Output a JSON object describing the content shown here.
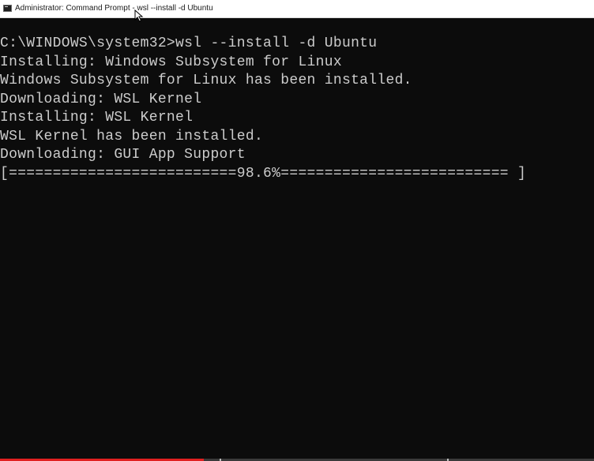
{
  "window": {
    "title": "Administrator: Command Prompt - wsl --install -d Ubuntu",
    "icon": "cmd-icon"
  },
  "console": {
    "lines": [
      "C:\\WINDOWS\\system32>wsl --install -d Ubuntu",
      "Installing: Windows Subsystem for Linux",
      "Windows Subsystem for Linux has been installed.",
      "Downloading: WSL Kernel",
      "Installing: WSL Kernel",
      "WSL Kernel has been installed.",
      "Downloading: GUI App Support",
      "[==========================98.6%========================== ]"
    ],
    "progress_percent": 98.6
  },
  "colors": {
    "console_bg": "#0c0c0c",
    "console_text": "#cccccc",
    "titlebar_bg": "#ffffff",
    "video_progress": "#e02020"
  }
}
